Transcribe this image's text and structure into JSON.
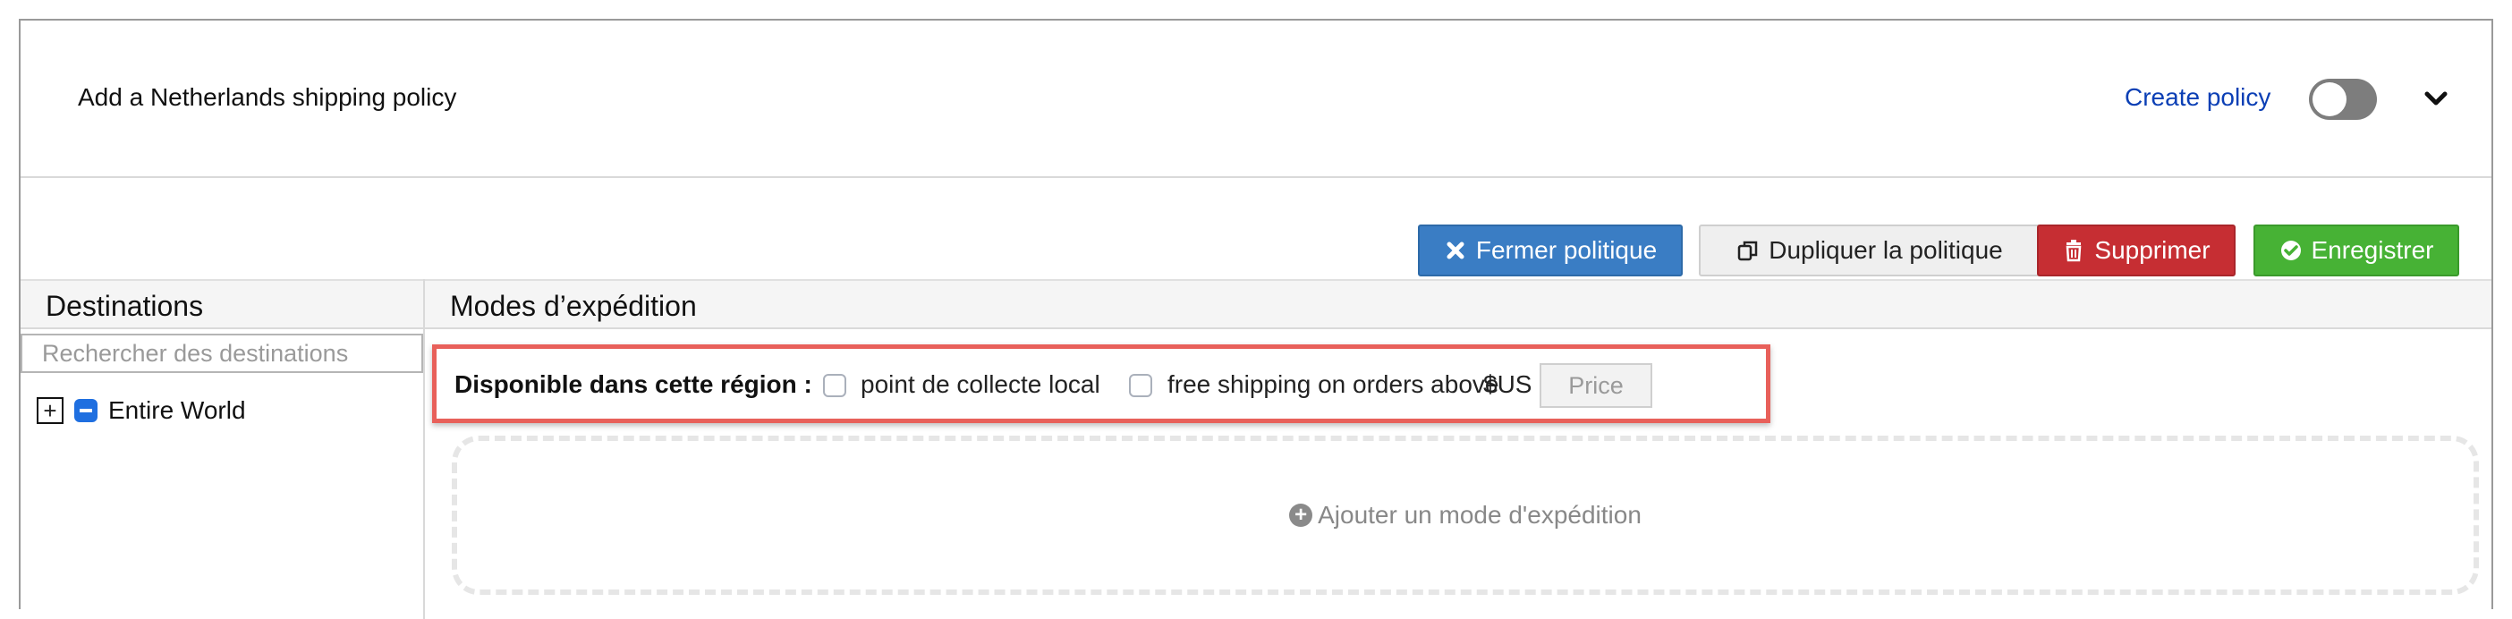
{
  "header": {
    "title": "Add a Netherlands shipping policy",
    "create_link": "Create policy"
  },
  "toolbar": {
    "close_label": "Fermer politique",
    "duplicate_label": "Dupliquer la politique",
    "delete_label": "Supprimer",
    "save_label": "Enregistrer"
  },
  "destinations": {
    "heading": "Destinations",
    "search_placeholder": "Rechercher des destinations",
    "tree": [
      {
        "label": "Entire World"
      }
    ]
  },
  "modes": {
    "heading": "Modes d’expédition",
    "available_label": "Disponible dans cette région :",
    "local_pickup_label": "point de collecte local",
    "free_shipping_label": "free shipping on orders above",
    "currency": "$US",
    "price_placeholder": "Price",
    "add_mode_label": "Ajouter un mode d'expédition"
  },
  "colors": {
    "link": "#0b3fb5",
    "close": "#3a7dc4",
    "delete": "#c62e33",
    "save": "#47b235",
    "highlight": "#e8605a"
  }
}
